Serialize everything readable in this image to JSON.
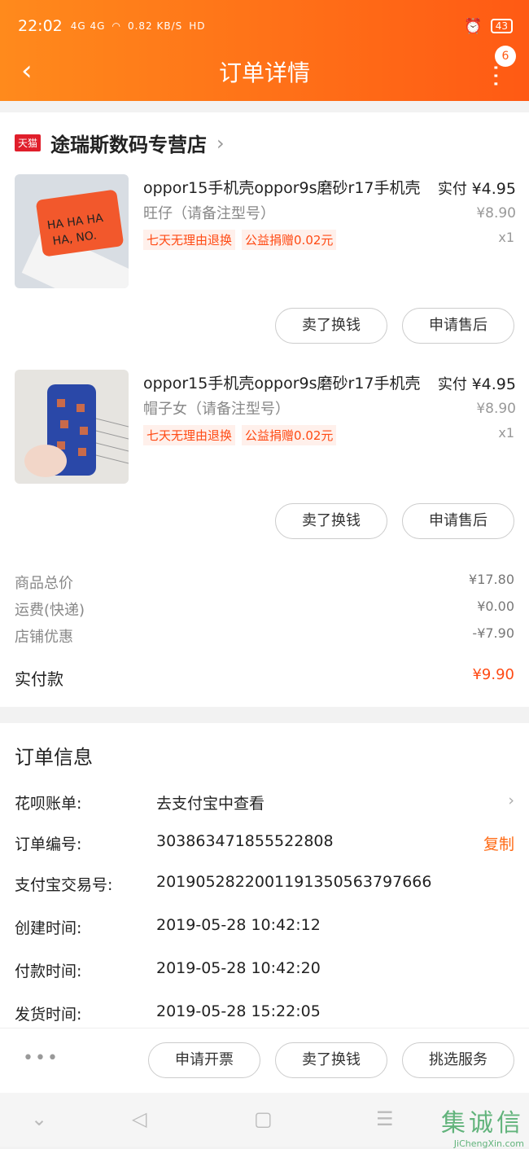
{
  "status": {
    "time": "22:02",
    "signal": "4G 4G",
    "speed": "0.82 KB/S",
    "hd": "HD",
    "battery": "43"
  },
  "header": {
    "title": "订单详情",
    "badge": "6"
  },
  "shop": {
    "tag": "天猫",
    "name": "途瑞斯数码专营店"
  },
  "items": [
    {
      "name": "oppor15手机壳oppor9s磨砂r17手机壳",
      "sku": "旺仔（请备注型号）",
      "tags": [
        "七天无理由退换",
        "公益捐赠0.02元"
      ],
      "paid_label": "实付",
      "paid": "¥4.95",
      "orig": "¥8.90",
      "qty": "x1",
      "btn1": "卖了换钱",
      "btn2": "申请售后"
    },
    {
      "name": "oppor15手机壳oppor9s磨砂r17手机壳",
      "sku": "帽子女（请备注型号）",
      "tags": [
        "七天无理由退换",
        "公益捐赠0.02元"
      ],
      "paid_label": "实付",
      "paid": "¥4.95",
      "orig": "¥8.90",
      "qty": "x1",
      "btn1": "卖了换钱",
      "btn2": "申请售后"
    }
  ],
  "summary": {
    "rows": [
      {
        "label": "商品总价",
        "value": "¥17.80"
      },
      {
        "label": "运费(快递)",
        "value": "¥0.00"
      },
      {
        "label": "店铺优惠",
        "value": "-¥7.90"
      }
    ],
    "total_label": "实付款",
    "total_value": "¥9.90"
  },
  "order_info": {
    "title": "订单信息",
    "rows": [
      {
        "label": "花呗账单:",
        "value": "去支付宝中查看"
      },
      {
        "label": "订单编号:",
        "value": "303863471855522808",
        "action": "复制"
      },
      {
        "label": "支付宝交易号:",
        "value": "2019052822001191350563797666"
      },
      {
        "label": "创建时间:",
        "value": "2019-05-28 10:42:12"
      },
      {
        "label": "付款时间:",
        "value": "2019-05-28 10:42:20"
      },
      {
        "label": "发货时间:",
        "value": "2019-05-28 15:22:05"
      }
    ]
  },
  "bottom": {
    "b1": "申请开票",
    "b2": "卖了换钱",
    "b3": "挑选服务"
  },
  "watermark": {
    "text": "集诚信",
    "url": "JiChengXin.com"
  },
  "colors": {
    "accent": "#ff5a14",
    "tag_bg": "#fff0eb"
  }
}
